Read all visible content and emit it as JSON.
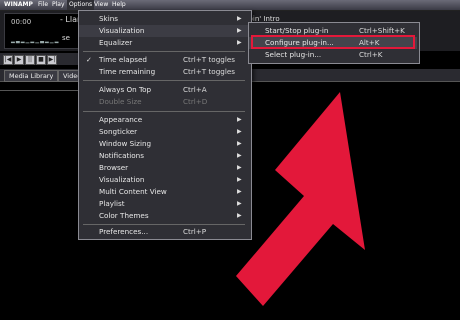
{
  "titlebar": {
    "app_title": "WINAMP",
    "menus": [
      "File",
      "Play",
      "Options",
      "View",
      "Help"
    ]
  },
  "player": {
    "time": "00:00",
    "song_title": "- Llama",
    "song_title_tail": "ppin' Intro",
    "se": "se"
  },
  "transport": {
    "buttons": [
      "|◀",
      "▶",
      "||",
      "■",
      "▶|"
    ]
  },
  "library": {
    "tabs": [
      "Media Library",
      "Video"
    ]
  },
  "options_menu": {
    "items": [
      {
        "label": "Skins",
        "shortcut": "",
        "submenu": true,
        "checked": false,
        "disabled": false
      },
      {
        "label": "Visualization",
        "shortcut": "",
        "submenu": true,
        "checked": false,
        "disabled": false,
        "highlighted": true
      },
      {
        "label": "Equalizer",
        "shortcut": "",
        "submenu": true,
        "checked": false,
        "disabled": false
      },
      {
        "label": "Time elapsed",
        "shortcut": "Ctrl+T toggles",
        "submenu": false,
        "checked": true,
        "disabled": false
      },
      {
        "label": "Time remaining",
        "shortcut": "Ctrl+T toggles",
        "submenu": false,
        "checked": false,
        "disabled": false
      },
      {
        "label": "Always On Top",
        "shortcut": "Ctrl+A",
        "submenu": false,
        "checked": false,
        "disabled": false
      },
      {
        "label": "Double Size",
        "shortcut": "Ctrl+D",
        "submenu": false,
        "checked": false,
        "disabled": true
      },
      {
        "label": "Appearance",
        "shortcut": "",
        "submenu": true,
        "checked": false,
        "disabled": false
      },
      {
        "label": "Songticker",
        "shortcut": "",
        "submenu": true,
        "checked": false,
        "disabled": false
      },
      {
        "label": "Window Sizing",
        "shortcut": "",
        "submenu": true,
        "checked": false,
        "disabled": false
      },
      {
        "label": "Notifications",
        "shortcut": "",
        "submenu": true,
        "checked": false,
        "disabled": false
      },
      {
        "label": "Browser",
        "shortcut": "",
        "submenu": true,
        "checked": false,
        "disabled": false
      },
      {
        "label": "Visualization",
        "shortcut": "",
        "submenu": true,
        "checked": false,
        "disabled": false
      },
      {
        "label": "Multi Content View",
        "shortcut": "",
        "submenu": true,
        "checked": false,
        "disabled": false
      },
      {
        "label": "Playlist",
        "shortcut": "",
        "submenu": true,
        "checked": false,
        "disabled": false
      },
      {
        "label": "Color Themes",
        "shortcut": "",
        "submenu": true,
        "checked": false,
        "disabled": false
      },
      {
        "label": "Preferences...",
        "shortcut": "Ctrl+P",
        "submenu": false,
        "checked": false,
        "disabled": false
      }
    ]
  },
  "visualization_submenu": {
    "items": [
      {
        "label": "Start/Stop plug-in",
        "shortcut": "Ctrl+Shift+K"
      },
      {
        "label": "Configure plug-in...",
        "shortcut": "Alt+K",
        "highlighted": true
      },
      {
        "label": "Select plug-in...",
        "shortcut": "Ctrl+K"
      }
    ]
  },
  "colors": {
    "highlight_box": "#e3183a",
    "arrow": "#e3183a",
    "menu_bg": "#2f2f35"
  }
}
